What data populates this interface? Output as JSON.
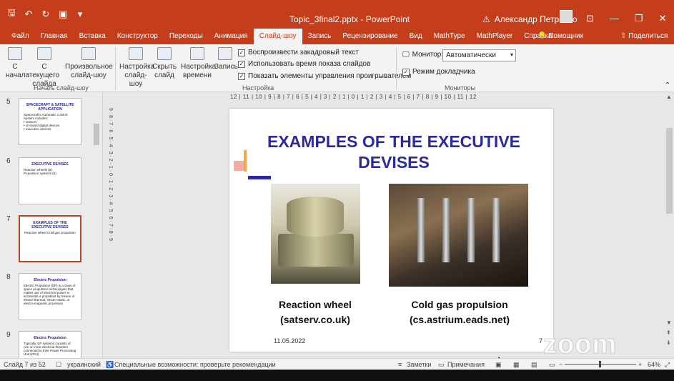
{
  "titlebar": {
    "doc_title": "Topic_3final2.pptx  -  PowerPoint",
    "user_name": "Александр Петренко",
    "warning_icon": "warning-icon"
  },
  "tabs": [
    "Файл",
    "Главная",
    "Вставка",
    "Конструктор",
    "Переходы",
    "Анимация",
    "Слайд-шоу",
    "Запись",
    "Рецензирование",
    "Вид",
    "MathType",
    "MathPlayer",
    "Справка"
  ],
  "tab_active_index": 6,
  "tab_help": "Помощник",
  "tab_share": "Поделиться",
  "ribbon": {
    "from_start": "С\nначала",
    "from_current": "С текущего\nслайда",
    "custom_show": "Произвольное\nслайд-шоу",
    "group_start": "Начать слайд-шоу",
    "setup_show": "Настройка\nслайд-шоу",
    "hide_slide": "Скрыть\nслайд",
    "rehearse": "Настройка\nвремени",
    "record": "Запись",
    "chk_narration": "Воспроизвести закадровый текст",
    "chk_timings": "Использовать время показа слайдов",
    "chk_controls": "Показать элементы управления проигрывателем",
    "group_setup": "Настройка",
    "monitor_label": "Монитор:",
    "monitor_value": "Автоматически",
    "chk_presenter": "Режим докладчика",
    "group_monitors": "Мониторы"
  },
  "thumbnails": [
    {
      "num": "5",
      "title": "SPACECRAFT & SATELLITE APPLICATION",
      "body": "Spacecraft's Automatic Control System includes:\n• sensors\n• on-board digital devices\n• executive devices"
    },
    {
      "num": "6",
      "title": "EXECUTIVE DEVISES",
      "body": "Reaction wheels (a)\nPropulsion systems (b)"
    },
    {
      "num": "7",
      "title": "EXAMPLES OF THE EXECUTIVE DEVISES",
      "body": "Reaction wheel    Cold gas propulsion"
    },
    {
      "num": "8",
      "title": "Electric Propulsion",
      "body": "Electric Propulsion (EP) is a class of space propulsion technologies that makes use of electrical power to accelerate a propellant by means of electro-thermal, electro-static, or electro-magnetic processes"
    },
    {
      "num": "9",
      "title": "Electric Propulsion",
      "body": "Typically, EP systems consists of one or more electrical thrusters connected to their Power Processing Unit (PPU)"
    }
  ],
  "ruler_h": "12 | 11 | 10 | 9 | 8 | 7 | 6 | 5 | 4 | 3 | 2 | 1 | 0 | 1 | 2 | 3 | 4 | 5 | 6 | 7 | 8 | 9 | 10 | 11 | 12",
  "ruler_v": "9 · 8 · 7 · 6 · 5 · 4 · 3 · 2 · 1 · 0 · 1 · 2 · 3 · 4 · 5 · 6 · 7 · 8 · 9",
  "slide": {
    "title": "EXAMPLES OF THE EXECUTIVE DEVISES",
    "caption_left": "Reaction wheel\n(satserv.co.uk)",
    "caption_right": "Cold gas propulsion\n(cs.astrium.eads.net)",
    "date": "11.05.2022",
    "number": "7"
  },
  "watermark": "zoom",
  "status": {
    "slide_of": "Слайд 7 из 52",
    "language": "украинский",
    "accessibility": "Специальные возможности: проверьте рекомендации",
    "notes": "Заметки",
    "comments": "Примечания",
    "zoom": "64%"
  },
  "colors": {
    "accent": "#c43e1c",
    "slide_title": "#2a2a9a"
  }
}
